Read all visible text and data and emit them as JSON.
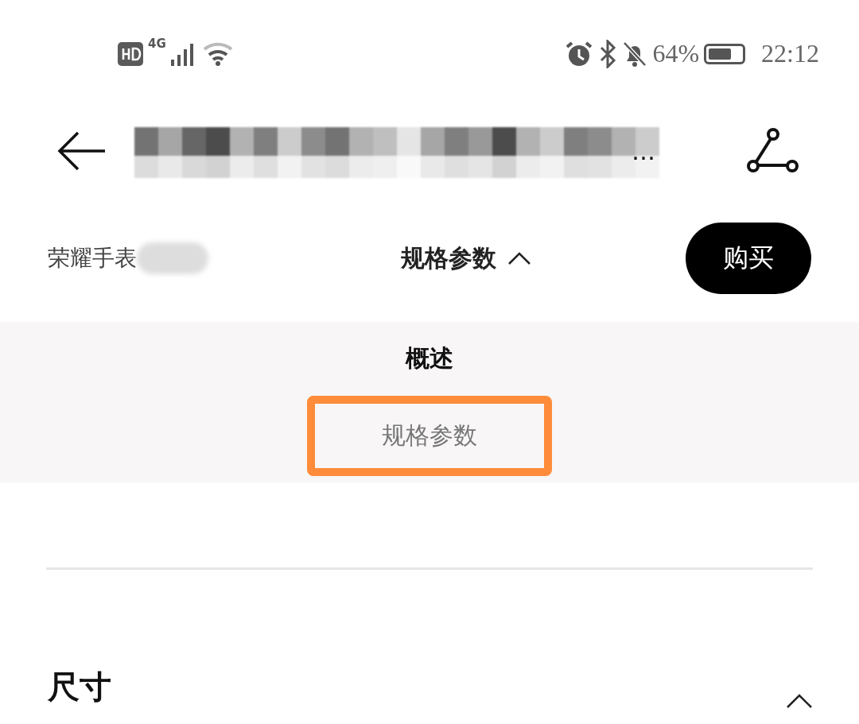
{
  "status_bar": {
    "network": "4G",
    "battery": "64%",
    "time": "22:12"
  },
  "header": {
    "title_tail": "…"
  },
  "subnav": {
    "product": "荣耀手表",
    "current": "规格参数",
    "expanded": true,
    "buy": "购买"
  },
  "dropdown": {
    "items": [
      {
        "label": "概述",
        "selected": true,
        "highlighted": false
      },
      {
        "label": "规格参数",
        "selected": false,
        "highlighted": true
      }
    ]
  },
  "section": {
    "title": "尺寸",
    "expanded": true
  }
}
